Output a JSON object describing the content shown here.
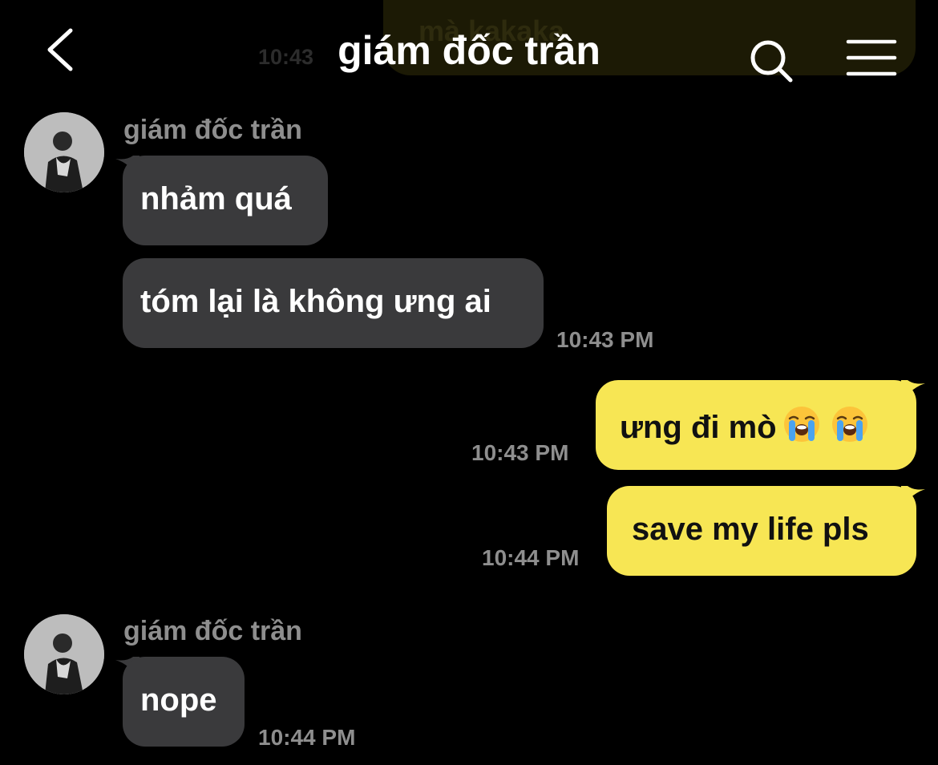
{
  "header": {
    "title": "giám đốc trần",
    "back_icon": "chevron-left-icon",
    "search_icon": "search-icon",
    "menu_icon": "menu-icon"
  },
  "previous_message": {
    "text_line2": "mà kakaka",
    "time": "10:43"
  },
  "colors": {
    "background": "#000000",
    "incoming_bubble": "#3a3a3c",
    "outgoing_bubble": "#f7e654",
    "muted_text": "#8e8e8e"
  },
  "messages": [
    {
      "sender": "giám đốc trần",
      "text": "nhảm quá"
    },
    {
      "text": "tóm lại là không ưng ai",
      "time": "10:43 PM"
    },
    {
      "text": "ưng đi mò",
      "emojis": [
        "loudly-crying-face-icon",
        "loudly-crying-face-icon"
      ],
      "time": "10:43 PM"
    },
    {
      "text": "save my life pls",
      "time": "10:44 PM"
    },
    {
      "sender": "giám đốc trần",
      "text": "nope",
      "time": "10:44 PM"
    }
  ]
}
